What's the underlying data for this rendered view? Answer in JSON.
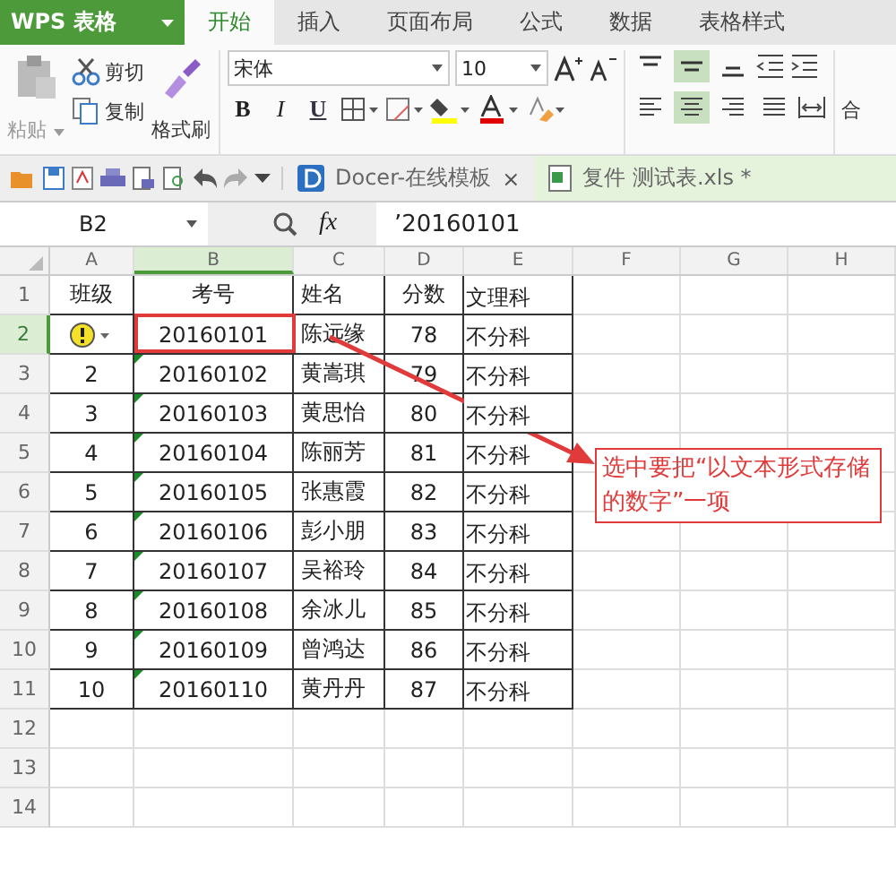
{
  "app": {
    "name": "WPS 表格",
    "menu_tabs": [
      {
        "label": "开始",
        "selected": true
      },
      {
        "label": "插入",
        "selected": false
      },
      {
        "label": "页面布局",
        "selected": false
      },
      {
        "label": "公式",
        "selected": false
      },
      {
        "label": "数据",
        "selected": false
      },
      {
        "label": "表格样式",
        "selected": false
      }
    ]
  },
  "ribbon": {
    "paste": "粘贴",
    "cut": "剪切",
    "copy": "复制",
    "format_painter": "格式刷",
    "font_name": "宋体",
    "font_size": "10",
    "bold": "B",
    "italic": "I",
    "underline": "U",
    "align_top": [
      {
        "kind": "top",
        "selected": false
      },
      {
        "kind": "middle",
        "selected": true
      },
      {
        "kind": "bottom",
        "selected": false
      }
    ],
    "align_h": [
      {
        "kind": "left",
        "selected": false
      },
      {
        "kind": "center",
        "selected": true
      },
      {
        "kind": "right",
        "selected": false
      },
      {
        "kind": "justify",
        "selected": false
      }
    ],
    "cut_off": "合"
  },
  "doc_tabs": [
    {
      "label": "Docer-在线模板",
      "close": "×",
      "selected": false
    },
    {
      "label": "复件 测试表.xls *",
      "selected": true
    }
  ],
  "formula_bar": {
    "cell_ref": "B2",
    "fx": "fx",
    "value": "’20160101"
  },
  "sheet": {
    "columns": [
      {
        "label": "A",
        "selected": false
      },
      {
        "label": "B",
        "selected": true
      },
      {
        "label": "C",
        "selected": false
      },
      {
        "label": "D",
        "selected": false
      },
      {
        "label": "E",
        "selected": false
      },
      {
        "label": "F",
        "selected": false
      },
      {
        "label": "G",
        "selected": false
      },
      {
        "label": "H",
        "selected": false
      }
    ],
    "rows": [
      {
        "number": "1",
        "selected": false,
        "warning": false,
        "flagged": false,
        "cells": [
          "班级",
          "考号",
          "姓名",
          "分数",
          "文理科"
        ]
      },
      {
        "number": "2",
        "selected": true,
        "warning": true,
        "flagged": false,
        "cells": [
          "",
          "20160101",
          "陈远缘",
          "78",
          "不分科"
        ]
      },
      {
        "number": "3",
        "selected": false,
        "warning": false,
        "flagged": true,
        "cells": [
          "2",
          "20160102",
          "黄嵩琪",
          "79",
          "不分科"
        ]
      },
      {
        "number": "4",
        "selected": false,
        "warning": false,
        "flagged": true,
        "cells": [
          "3",
          "20160103",
          "黄思怡",
          "80",
          "不分科"
        ]
      },
      {
        "number": "5",
        "selected": false,
        "warning": false,
        "flagged": true,
        "cells": [
          "4",
          "20160104",
          "陈丽芳",
          "81",
          "不分科"
        ]
      },
      {
        "number": "6",
        "selected": false,
        "warning": false,
        "flagged": true,
        "cells": [
          "5",
          "20160105",
          "张惠霞",
          "82",
          "不分科"
        ]
      },
      {
        "number": "7",
        "selected": false,
        "warning": false,
        "flagged": true,
        "cells": [
          "6",
          "20160106",
          "彭小朋",
          "83",
          "不分科"
        ]
      },
      {
        "number": "8",
        "selected": false,
        "warning": false,
        "flagged": true,
        "cells": [
          "7",
          "20160107",
          "吴裕玲",
          "84",
          "不分科"
        ]
      },
      {
        "number": "9",
        "selected": false,
        "warning": false,
        "flagged": true,
        "cells": [
          "8",
          "20160108",
          "余冰儿",
          "85",
          "不分科"
        ]
      },
      {
        "number": "10",
        "selected": false,
        "warning": false,
        "flagged": true,
        "cells": [
          "9",
          "20160109",
          "曾鸿达",
          "86",
          "不分科"
        ]
      },
      {
        "number": "11",
        "selected": false,
        "warning": false,
        "flagged": true,
        "cells": [
          "10",
          "20160110",
          "黄丹丹",
          "87",
          "不分科"
        ]
      },
      {
        "number": "12",
        "selected": false,
        "warning": false,
        "flagged": false,
        "cells": []
      },
      {
        "number": "13",
        "selected": false,
        "warning": false,
        "flagged": false,
        "cells": []
      },
      {
        "number": "14",
        "selected": false,
        "warning": false,
        "flagged": false,
        "cells": []
      }
    ]
  },
  "annotation": {
    "text": "选中要把“以文本形式存储的数字”一项"
  }
}
